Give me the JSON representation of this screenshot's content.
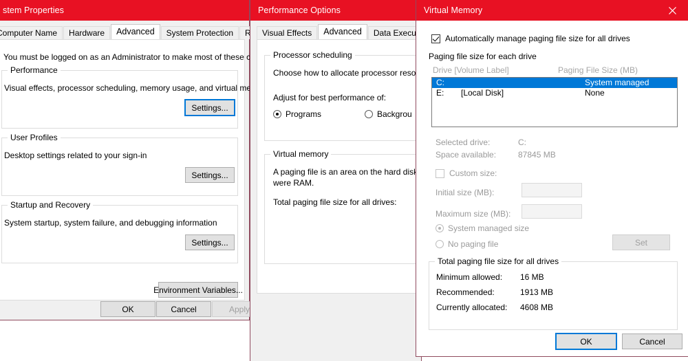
{
  "system_properties": {
    "title": "stem Properties",
    "tabs": [
      {
        "label": "Computer Name",
        "active": false
      },
      {
        "label": "Hardware",
        "active": false
      },
      {
        "label": "Advanced",
        "active": true
      },
      {
        "label": "System Protection",
        "active": false
      },
      {
        "label": "Remote",
        "active": false
      }
    ],
    "notice": "You must be logged on as an Administrator to make most of these changes.",
    "performance": {
      "legend": "Performance",
      "description": "Visual effects, processor scheduling, memory usage, and virtual memory",
      "settings_button": "Settings..."
    },
    "user_profiles": {
      "legend": "User Profiles",
      "description": "Desktop settings related to your sign-in",
      "settings_button": "Settings..."
    },
    "startup_recovery": {
      "legend": "Startup and Recovery",
      "description": "System startup, system failure, and debugging information",
      "settings_button": "Settings..."
    },
    "environment_variables_button": "Environment Variables...",
    "ok_button": "OK",
    "cancel_button": "Cancel",
    "apply_button": "Apply"
  },
  "performance_options": {
    "title": "Performance Options",
    "tabs": [
      {
        "label": "Visual Effects",
        "active": false
      },
      {
        "label": "Advanced",
        "active": true
      },
      {
        "label": "Data Execution Pre",
        "active": false
      }
    ],
    "processor_scheduling": {
      "legend": "Processor scheduling",
      "description": "Choose how to allocate processor resou",
      "adjust_label": "Adjust for best performance of:",
      "option_programs": "Programs",
      "option_background": "Backgrou",
      "selected": "Programs"
    },
    "virtual_memory": {
      "legend": "Virtual memory",
      "description_line1": "A paging file is an area on the hard disk",
      "description_line2": "were RAM.",
      "total_label": "Total paging file size for all drives:"
    }
  },
  "virtual_memory": {
    "title": "Virtual Memory",
    "close_icon": "close-icon",
    "auto_manage": {
      "label": "Automatically manage paging file size for all drives",
      "checked": true
    },
    "paging_list": {
      "legend": "Paging file size for each drive",
      "columns": [
        "Drive  [Volume Label]",
        "Paging File Size (MB)"
      ],
      "rows": [
        {
          "drive": "C:",
          "label": "",
          "size": "System managed",
          "selected": true
        },
        {
          "drive": "E:",
          "label": "[Local Disk]",
          "size": "None",
          "selected": false
        }
      ]
    },
    "selected_drive_label": "Selected drive:",
    "selected_drive_value": "C:",
    "space_available_label": "Space available:",
    "space_available_value": "87845 MB",
    "custom_size": {
      "label": "Custom size:",
      "checked": false
    },
    "initial_size_label": "Initial size (MB):",
    "initial_size_value": "",
    "maximum_size_label": "Maximum size (MB):",
    "maximum_size_value": "",
    "system_managed_size": {
      "label": "System managed size",
      "selected": true
    },
    "no_paging_file": {
      "label": "No paging file",
      "selected": false
    },
    "set_button": "Set",
    "totals": {
      "legend": "Total paging file size for all drives",
      "rows": [
        {
          "label": "Minimum allowed:",
          "value": "16 MB"
        },
        {
          "label": "Recommended:",
          "value": "1913 MB"
        },
        {
          "label": "Currently allocated:",
          "value": "4608 MB"
        }
      ]
    },
    "ok_button": "OK",
    "cancel_button": "Cancel"
  },
  "colors": {
    "titlebar": "#e81123",
    "selection": "#0078d7",
    "dialog_bg": "#f0f0f0"
  }
}
